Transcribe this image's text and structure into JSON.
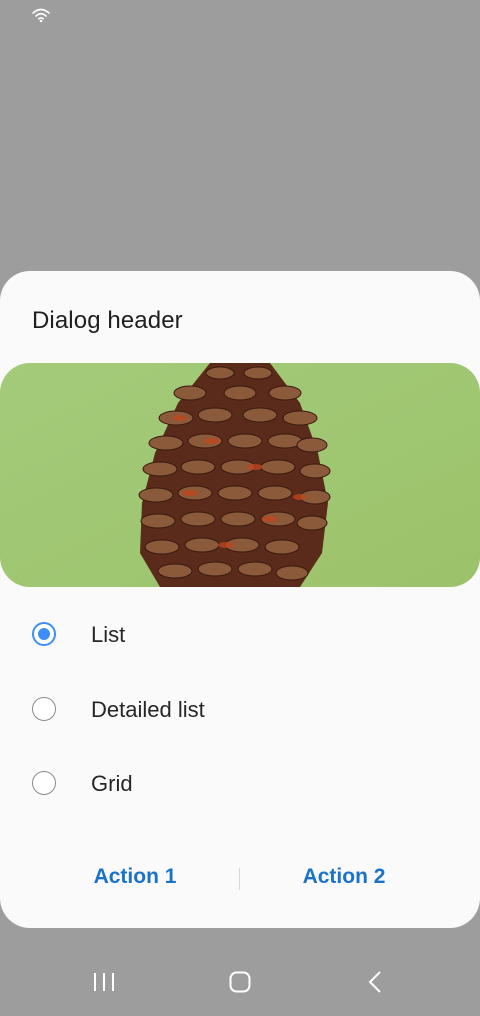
{
  "dialog": {
    "header": "Dialog header",
    "image": {
      "alt": "pine cone on green background",
      "background_color": "#9cc46f"
    },
    "options": [
      {
        "label": "List",
        "selected": true
      },
      {
        "label": "Detailed list",
        "selected": false
      },
      {
        "label": "Grid",
        "selected": false
      }
    ],
    "actions": [
      {
        "label": "Action 1"
      },
      {
        "label": "Action 2"
      }
    ]
  },
  "colors": {
    "accent": "#3e8ef7",
    "action_text": "#1a73c9",
    "scrim": "#9d9d9d",
    "dialog_bg": "#fafafa"
  },
  "status_bar": {
    "icons": [
      "wifi-icon"
    ]
  },
  "nav_bar": {
    "buttons": [
      "recent-apps",
      "home",
      "back"
    ]
  }
}
